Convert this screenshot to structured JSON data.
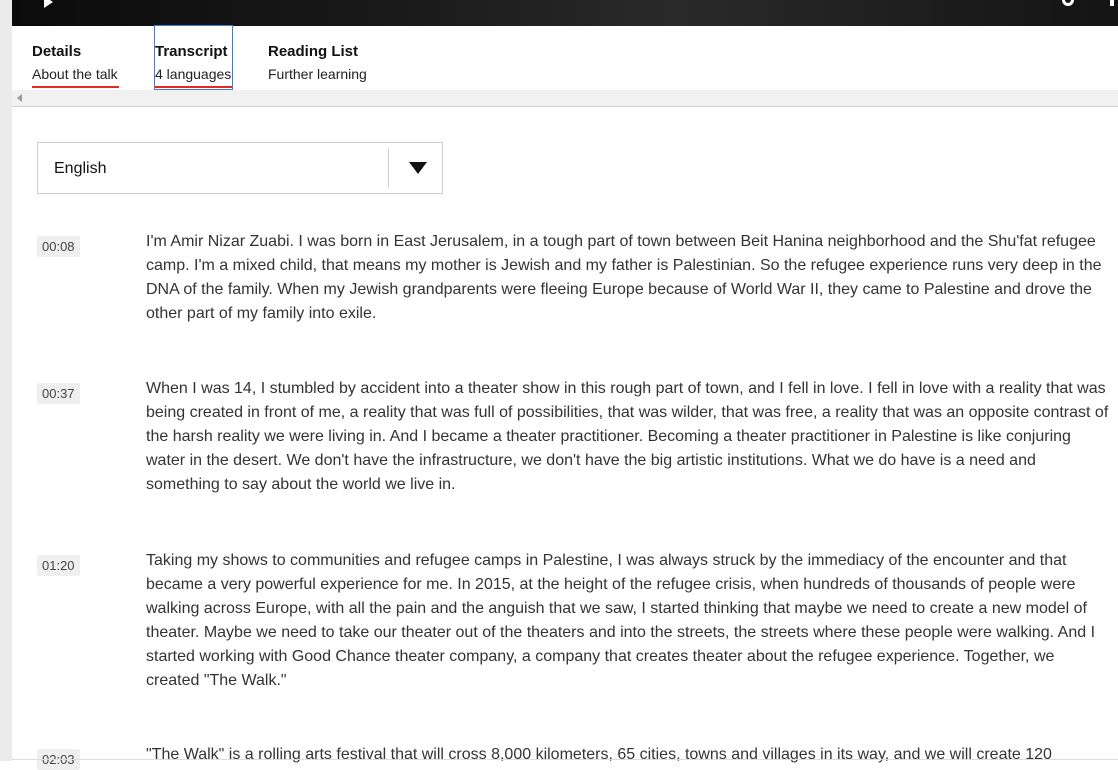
{
  "tabs": [
    {
      "title": "Details",
      "subtitle": "About the talk"
    },
    {
      "title": "Transcript",
      "subtitle": "4 languages"
    },
    {
      "title": "Reading List",
      "subtitle": "Further learning"
    }
  ],
  "language_select": {
    "value": "English"
  },
  "transcript": [
    {
      "time": "00:08",
      "text": "I'm Amir Nizar Zuabi. I was born in East Jerusalem, in a tough part of town between Beit Hanina neighborhood and the Shu'fat refugee camp. I'm a mixed child, that means my mother is Jewish and my father is Palestinian. So the refugee experience runs very deep in the DNA of the family. When my Jewish grandparents were fleeing Europe because of World War II, they came to Palestine and drove the other part of my family into exile."
    },
    {
      "time": "00:37",
      "text": "When I was 14, I stumbled by accident into a theater show in this rough part of town, and I fell in love. I fell in love with a reality that was being created in front of me, a reality that was full of possibilities, that was wilder, that was free, a reality that was an opposite contrast of the harsh reality we were living in. And I became a theater practitioner. Becoming a theater practitioner in Palestine is like conjuring water in the desert. We don't have the infrastructure, we don't have the big artistic institutions. What we do have is a need and something to say about the world we live in."
    },
    {
      "time": "01:20",
      "text": "Taking my shows to communities and refugee camps in Palestine, I was always struck by the immediacy of the encounter and that became a very powerful experience for me. In 2015, at the height of the refugee crisis, when hundreds of thousands of people were walking across Europe, with all the pain and the anguish that we saw, I started thinking that maybe we need to create a new model of theater. Maybe we need to take our theater out of the theaters and into the streets, the streets where these people were walking. And I started working with Good Chance theater company, a company that creates theater about the refugee experience. Together, we created \"The Walk.\""
    },
    {
      "time": "02:03",
      "text": "\"The Walk\" is a rolling arts festival that will cross 8,000 kilometers, 65 cities, towns and villages in its way, and we will create 120"
    }
  ]
}
